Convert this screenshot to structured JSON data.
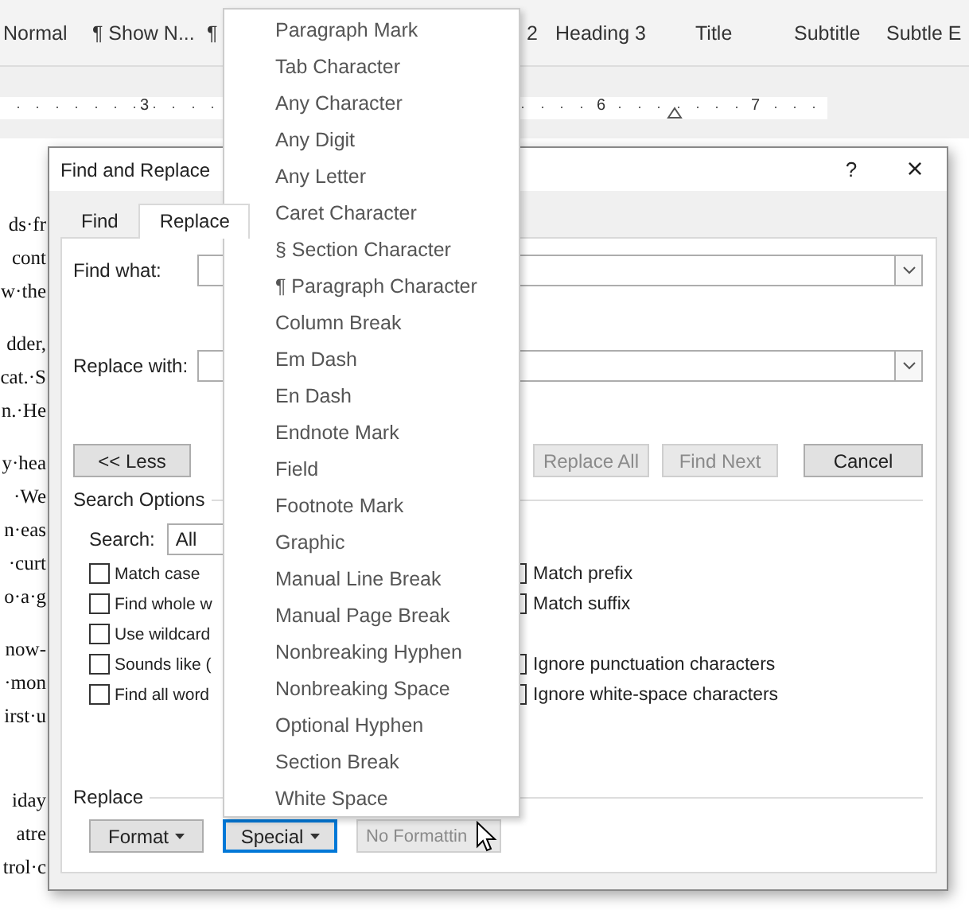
{
  "ribbon": {
    "styles": [
      "Normal",
      "¶ Show N...",
      "¶",
      "2",
      "Heading 3",
      "Title",
      "Subtitle",
      "Subtle E"
    ]
  },
  "ruler": {
    "numbers": [
      {
        "label": "3"
      },
      {
        "label": "6"
      },
      {
        "label": "7"
      }
    ]
  },
  "document": {
    "paragraphs": [
      [
        "ds·fr",
        "cont",
        "w·the"
      ],
      [
        "dder,",
        "cat.·S",
        "n.·He"
      ],
      [
        "y·hea",
        "·We",
        "n·eas",
        "·curt",
        "o·a·g"
      ],
      [
        "now-",
        "·mon",
        "irst·u"
      ],
      [
        "iday",
        "atre",
        "trol·c"
      ]
    ]
  },
  "dialog": {
    "title": "Find and Replace",
    "help": "?",
    "close": "×",
    "tabs": [
      {
        "label": "Find",
        "selected": false
      },
      {
        "label": "Replace",
        "selected": true
      }
    ],
    "find_label": "Find what:",
    "replace_label": "Replace with:",
    "less_button": "<< Less",
    "action_buttons": [
      {
        "label": "Replace All",
        "disabled": true
      },
      {
        "label": "Find Next",
        "disabled": true
      },
      {
        "label": "Cancel",
        "disabled": false
      }
    ],
    "search_options": {
      "title": "Search Options",
      "search_label": "Search:",
      "search_value": "All",
      "left_options": [
        {
          "label": "Match case",
          "checked": false
        },
        {
          "label": "Find whole w",
          "checked": false
        },
        {
          "label": "Use wildcard",
          "checked": false
        },
        {
          "label": "Sounds like (",
          "checked": false
        },
        {
          "label": "Find all word",
          "checked": false
        }
      ],
      "prefix_options": [
        {
          "label": "Match prefix",
          "checked": false
        },
        {
          "label": "Match suffix",
          "checked": false
        }
      ],
      "ignore_options": [
        {
          "label": "Ignore punctuation characters",
          "checked": false
        },
        {
          "label": "Ignore white-space characters",
          "checked": false
        }
      ]
    },
    "replace_group": {
      "title": "Replace",
      "buttons": [
        {
          "label": "Format",
          "dropdown": true,
          "focused": false,
          "disabled": false
        },
        {
          "label": "Special",
          "dropdown": true,
          "focused": true,
          "disabled": false
        },
        {
          "label": "No Formattin",
          "dropdown": false,
          "focused": false,
          "disabled": true
        }
      ]
    }
  },
  "special_menu": {
    "items": [
      "Paragraph Mark",
      "Tab Character",
      "Any Character",
      "Any Digit",
      "Any Letter",
      "Caret Character",
      "§ Section Character",
      "¶ Paragraph Character",
      "Column Break",
      "Em Dash",
      "En Dash",
      "Endnote Mark",
      "Field",
      "Footnote Mark",
      "Graphic",
      "Manual Line Break",
      "Manual Page Break",
      "Nonbreaking Hyphen",
      "Nonbreaking Space",
      "Optional Hyphen",
      "Section Break",
      "White Space"
    ]
  }
}
